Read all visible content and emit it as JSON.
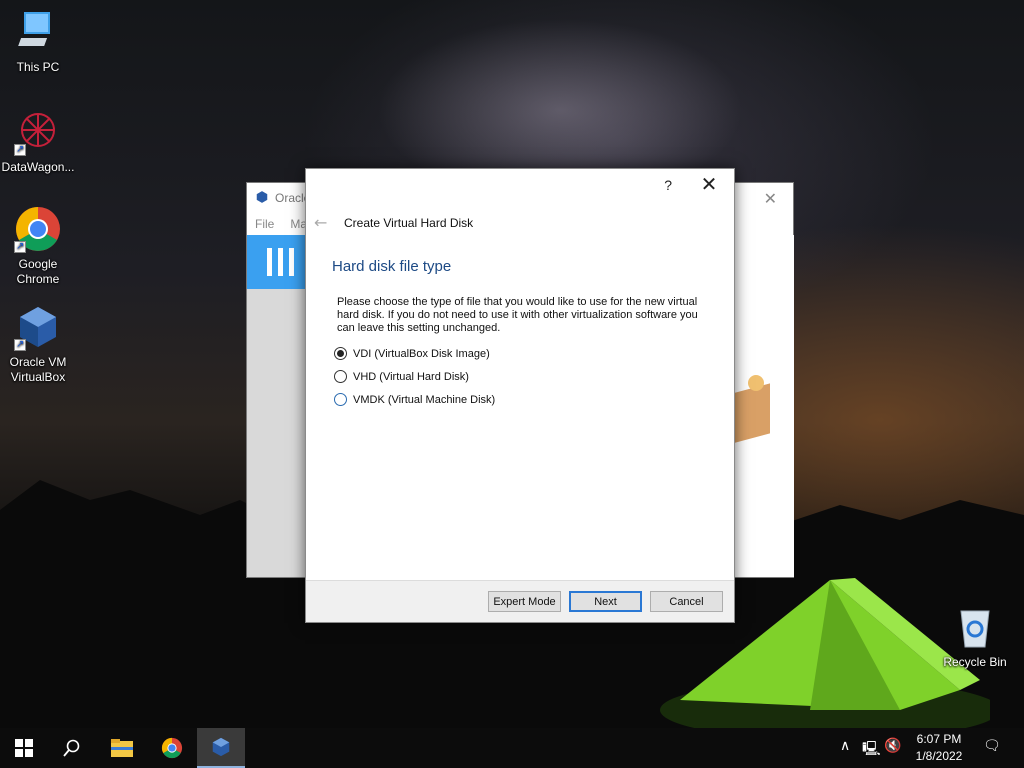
{
  "desktop": {
    "icons": [
      {
        "label": "This PC"
      },
      {
        "label": "DataWagon..."
      },
      {
        "label": "Google Chrome"
      },
      {
        "label": "Oracle VM VirtualBox"
      },
      {
        "label": "Recycle Bin"
      }
    ]
  },
  "background_window": {
    "title": "Oracle",
    "menu": [
      "File",
      "Ma"
    ]
  },
  "dialog": {
    "help_label": "?",
    "close_label": "✕",
    "header_title": "Create Virtual Hard Disk",
    "heading": "Hard disk file type",
    "description": "Please choose the type of file that you would like to use for the new virtual hard disk. If you do not need to use it with other virtualization software you can leave this setting unchanged.",
    "options": [
      {
        "label": "VDI (VirtualBox Disk Image)",
        "selected": true
      },
      {
        "label": "VHD (Virtual Hard Disk)",
        "selected": false
      },
      {
        "label": "VMDK (Virtual Machine Disk)",
        "selected": false
      }
    ],
    "buttons": {
      "expert": "Expert Mode",
      "next": "Next",
      "cancel": "Cancel"
    }
  },
  "taskbar": {
    "time": "6:07 PM",
    "date": "1/8/2022",
    "icons": [
      "windows-start-icon",
      "search-icon",
      "file-explorer-icon",
      "chrome-icon",
      "virtualbox-icon"
    ]
  },
  "colors": {
    "heading": "#1d4a85",
    "accent": "#2a78d4",
    "toolbar_blue": "#3aa0f0"
  }
}
